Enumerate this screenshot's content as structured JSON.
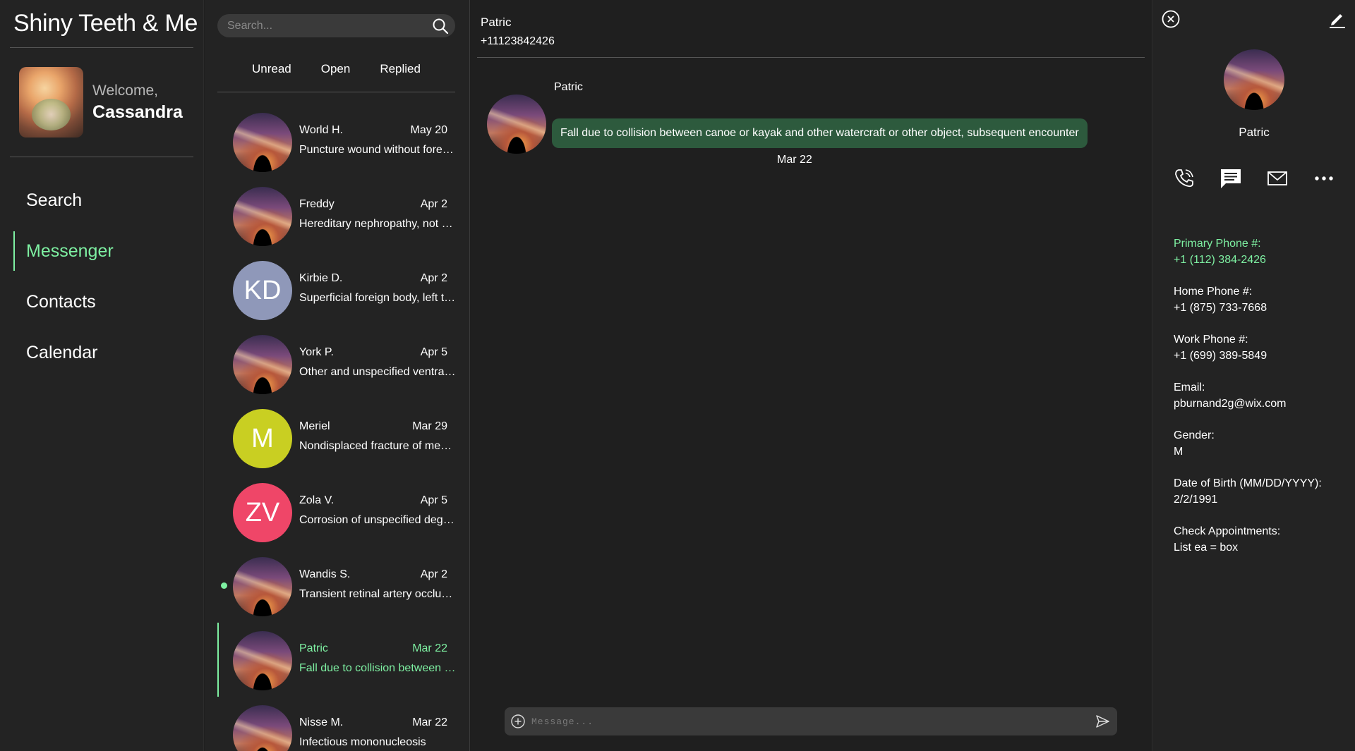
{
  "app": {
    "title": "Shiny Teeth & Me"
  },
  "user": {
    "welcome": "Welcome,",
    "name": "Cassandra"
  },
  "nav": {
    "items": [
      {
        "label": "Search",
        "active": false
      },
      {
        "label": "Messenger",
        "active": true
      },
      {
        "label": "Contacts",
        "active": false
      },
      {
        "label": "Calendar",
        "active": false
      }
    ]
  },
  "search": {
    "placeholder": "Search..."
  },
  "filters": [
    "Unread",
    "Open",
    "Replied"
  ],
  "conversations": [
    {
      "name": "World H.",
      "date": "May 20",
      "preview": "Puncture wound without foreign body of right lesser toe(s) without damage to nail",
      "avatar": "photo-galaxy",
      "unread": false,
      "selected": false
    },
    {
      "name": "Freddy",
      "date": "Apr 2",
      "preview": "Hereditary nephropathy, not elsewhere classified with focal and segmental glomerular lesions",
      "avatar": "photo-galaxy",
      "unread": false,
      "selected": false
    },
    {
      "name": "Kirbie D.",
      "date": "Apr 2",
      "preview": "Superficial foreign body, left thumb, subsequent encounter",
      "avatar": "initials",
      "initials": "KD",
      "avatar_color": "#8f98b9",
      "unread": false,
      "selected": false
    },
    {
      "name": "York P.",
      "date": "Apr 5",
      "preview": "Other and unspecified ventral hernia with obstruction",
      "avatar": "photo-galaxy",
      "unread": false,
      "selected": false
    },
    {
      "name": "Meriel",
      "date": "Mar 29",
      "preview": "Nondisplaced fracture of medial condyle of left femur",
      "avatar": "initials",
      "initials": "M",
      "avatar_color": "#c9cf22",
      "unread": false,
      "selected": false
    },
    {
      "name": "Zola V.",
      "date": "Apr 5",
      "preview": "Corrosion of unspecified degree of right wrist",
      "avatar": "initials",
      "initials": "ZV",
      "avatar_color": "#ef4668",
      "unread": false,
      "selected": false
    },
    {
      "name": "Wandis S.",
      "date": "Apr 2",
      "preview": "Transient retinal artery occlusion, bilateral",
      "avatar": "photo-galaxy",
      "unread": true,
      "selected": false
    },
    {
      "name": "Patric",
      "date": "Mar 22",
      "preview": "Fall due to collision between canoe or kayak and other watercraft or other object, subsequent encounter",
      "avatar": "photo-galaxy",
      "unread": false,
      "selected": true
    },
    {
      "name": "Nisse M.",
      "date": "Mar 22",
      "preview": "Infectious mononucleosis",
      "avatar": "photo-galaxy",
      "unread": false,
      "selected": false
    }
  ],
  "chat": {
    "name": "Patric",
    "phone": "+11123842426",
    "message": {
      "sender": "Patric",
      "text": "Fall due to collision between canoe or kayak and other watercraft or other object, subsequent encounter",
      "date": "Mar 22"
    },
    "composer_placeholder": "Message..."
  },
  "contact": {
    "name": "Patric",
    "fields": [
      {
        "label": "Primary Phone #:",
        "value": "+1 (112) 384-2426",
        "primary": true
      },
      {
        "label": "Home Phone #:",
        "value": "+1 (875) 733-7668",
        "primary": false
      },
      {
        "label": "Work Phone #:",
        "value": "+1 (699) 389-5849",
        "primary": false
      },
      {
        "label": "Email:",
        "value": "pburnand2g@wix.com",
        "primary": false
      },
      {
        "label": "Gender:",
        "value": "M",
        "primary": false
      },
      {
        "label": "Date of Birth (MM/DD/YYYY):",
        "value": "2/2/1991",
        "primary": false
      },
      {
        "label": "Check Appointments:",
        "value": "List ea = box",
        "primary": false
      }
    ]
  },
  "icons": [
    "search-icon",
    "add-icon",
    "send-icon",
    "close-icon",
    "edit-icon",
    "phone-icon",
    "chat-icon",
    "mail-icon",
    "more-icon"
  ],
  "colors": {
    "accent": "#7ef0a2",
    "bubble": "#2d5a3d",
    "background": "#1f1f1f",
    "panel": "#232323"
  }
}
